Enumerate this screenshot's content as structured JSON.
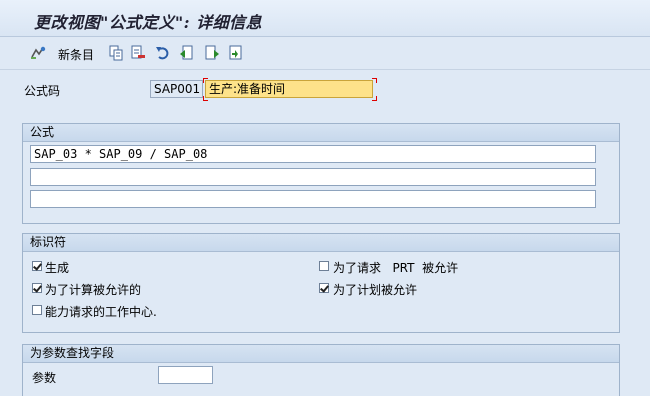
{
  "window": {
    "title": "更改视图\"公式定义\": 详细信息"
  },
  "toolbar": {
    "icons": [
      "change-display-icon",
      "new-entries-icon",
      "copy-icon",
      "delete-icon",
      "undo-icon",
      "previous-entry-icon",
      "next-entry-icon",
      "select-all-icon"
    ],
    "new_entries_label": "新条目"
  },
  "formula_code": {
    "label": "公式码",
    "code": "SAP001",
    "description": "生产:准备时间"
  },
  "formula_group": {
    "title": "公式",
    "lines": [
      "SAP_03 * SAP_09 / SAP_08",
      "",
      ""
    ]
  },
  "indicators": {
    "title": "标识符",
    "items": [
      {
        "label": "生成",
        "checked": true
      },
      {
        "label": "为了计算被允许的",
        "checked": true
      },
      {
        "label": "能力请求的工作中心.",
        "checked": false
      },
      {
        "label": "为了请求   PRT  被允许",
        "checked": false
      },
      {
        "label": "为了计划被允许",
        "checked": true
      }
    ]
  },
  "param_group": {
    "title": "为参数查找字段",
    "param_label": "参数",
    "param_value": ""
  },
  "colors": {
    "highlight": "#fde28a",
    "background": "#dfe9f5"
  }
}
